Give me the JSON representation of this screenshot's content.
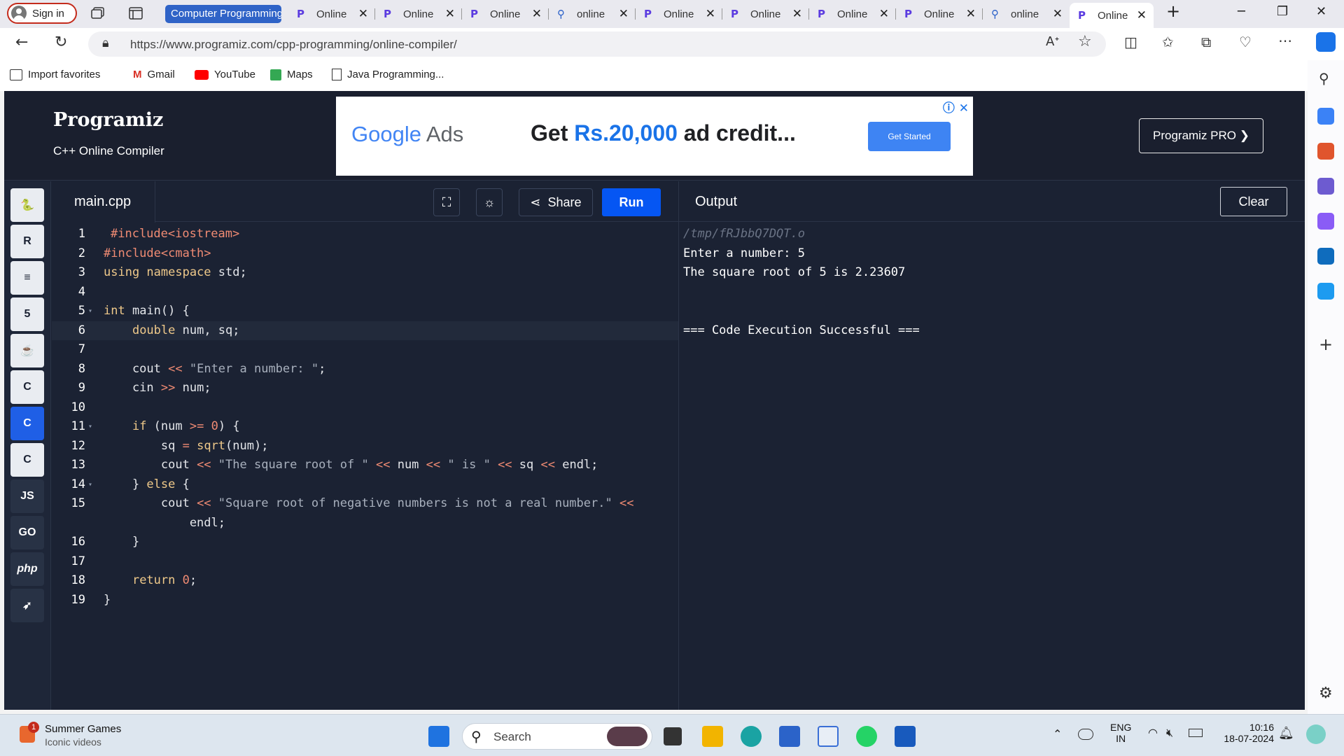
{
  "browser": {
    "signin_label": "Sign in",
    "tab_group_label": "Computer Programming",
    "tabs": [
      {
        "title": "Online",
        "icon": "programiz-favicon"
      },
      {
        "title": "Online",
        "icon": "programiz-favicon"
      },
      {
        "title": "Online",
        "icon": "programiz-favicon"
      },
      {
        "title": "online",
        "icon": "search-favicon"
      },
      {
        "title": "Online",
        "icon": "programiz-favicon"
      },
      {
        "title": "Online",
        "icon": "programiz-favicon"
      },
      {
        "title": "Online",
        "icon": "programiz-favicon"
      },
      {
        "title": "Online",
        "icon": "programiz-favicon"
      },
      {
        "title": "online",
        "icon": "search-favicon"
      },
      {
        "title": "Online",
        "icon": "programiz-favicon",
        "active": true
      }
    ],
    "url": "https://www.programiz.com/cpp-programming/online-compiler/",
    "favorites": [
      {
        "label": "Import favorites",
        "icon": "import-icon"
      },
      {
        "label": "Gmail",
        "icon": "gmail-icon"
      },
      {
        "label": "YouTube",
        "icon": "youtube-icon"
      },
      {
        "label": "Maps",
        "icon": "maps-icon"
      },
      {
        "label": "Java Programming...",
        "icon": "page-icon"
      }
    ]
  },
  "header": {
    "logo": "Programiz",
    "subtitle": "C++ Online Compiler",
    "pro_button": "Programiz PRO ❯",
    "ad": {
      "brand_google": "Google",
      "brand_ads": "Ads",
      "text_get": "Get ",
      "text_amount": "Rs.20,000",
      "text_rest": " ad credit...",
      "button": "Get Started",
      "info": "ⓘ",
      "close": "✕"
    }
  },
  "sidebar_langs": [
    {
      "name": "python",
      "glyph": "🐍"
    },
    {
      "name": "r",
      "glyph": "R"
    },
    {
      "name": "sql",
      "glyph": "≡"
    },
    {
      "name": "html",
      "glyph": "5"
    },
    {
      "name": "java",
      "glyph": "☕"
    },
    {
      "name": "c",
      "glyph": "C"
    },
    {
      "name": "cpp",
      "glyph": "C",
      "active": true
    },
    {
      "name": "csharp",
      "glyph": "C"
    },
    {
      "name": "js",
      "glyph": "JS"
    },
    {
      "name": "go",
      "glyph": "GO"
    },
    {
      "name": "php",
      "glyph": "php"
    },
    {
      "name": "swift",
      "glyph": "➶"
    }
  ],
  "editor": {
    "filename": "main.cpp",
    "share_label": "Share",
    "run_label": "Run",
    "active_line": 6
  },
  "output": {
    "title": "Output",
    "clear_label": "Clear",
    "path": "/tmp/fRJbbQ7DQT.o",
    "lines": [
      "Enter a number: 5",
      "The square root of 5 is 2.23607",
      "",
      "",
      "=== Code Execution Successful ==="
    ]
  },
  "taskbar": {
    "widget_title": "Summer Games",
    "widget_sub": "Iconic videos",
    "widget_badge": "1",
    "search_placeholder": "Search",
    "lang": "ENG",
    "region": "IN",
    "time": "10:16",
    "date": "18-07-2024"
  },
  "colors": {
    "app_bg": "#1b2233",
    "run_button": "#0556f3",
    "cpp_active": "#1f5fe6",
    "keyword": "#efc98a",
    "string": "#a8b0bd",
    "number": "#f08b73"
  }
}
